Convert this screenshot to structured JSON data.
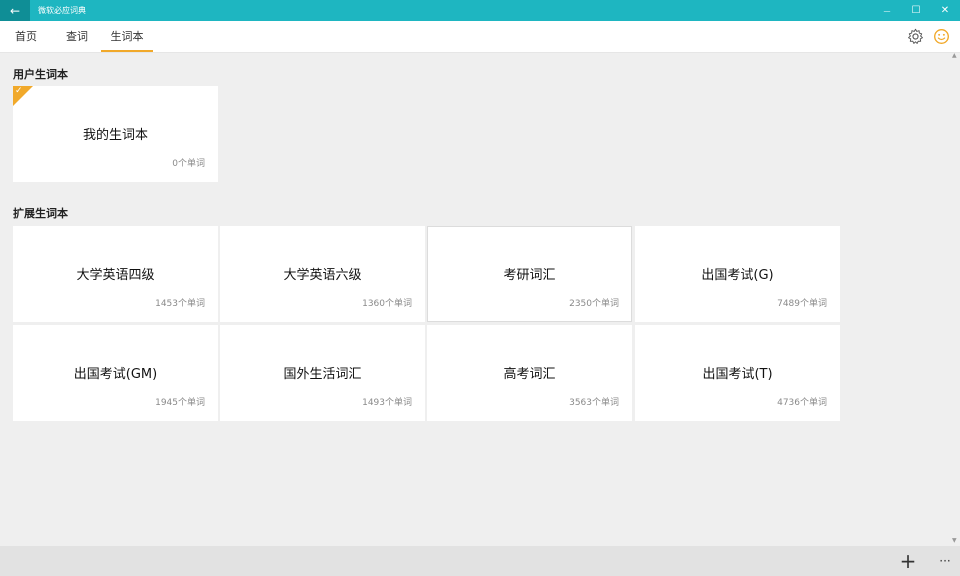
{
  "window": {
    "title": "微软必应词典",
    "back_glyph": "←",
    "minimize_glyph": "—",
    "maximize_glyph": "☐",
    "close_glyph": "✕"
  },
  "nav": {
    "tabs": [
      {
        "label": "首页"
      },
      {
        "label": "查词"
      },
      {
        "label": "生词本"
      }
    ],
    "active_tab": "生词本",
    "accent_color": "#f1a92a"
  },
  "user_section": {
    "title": "用户生词本",
    "cards": [
      {
        "name": "我的生词本",
        "count": "0个单词",
        "selected": true
      }
    ]
  },
  "extended_section": {
    "title": "扩展生词本",
    "cards": [
      {
        "name": "大学英语四级",
        "count": "1453个单词"
      },
      {
        "name": "大学英语六级",
        "count": "1360个单词"
      },
      {
        "name": "考研词汇",
        "count": "2350个单词"
      },
      {
        "name": "出国考试(G)",
        "count": "7489个单词"
      },
      {
        "name": "出国考试(GM)",
        "count": "1945个单词"
      },
      {
        "name": "国外生活词汇",
        "count": "1493个单词"
      },
      {
        "name": "高考词汇",
        "count": "3563个单词"
      },
      {
        "name": "出国考试(T)",
        "count": "4736个单词"
      }
    ]
  },
  "appbar": {
    "add_glyph": "+",
    "more_glyph": "···"
  },
  "icons": {
    "settings": "gear-icon",
    "feedback": "smiley-icon",
    "selected": "checkmark-icon"
  },
  "colors": {
    "titlebar": "#1eb6c1",
    "back_button": "#0f8e96",
    "accent": "#f1a92a"
  }
}
